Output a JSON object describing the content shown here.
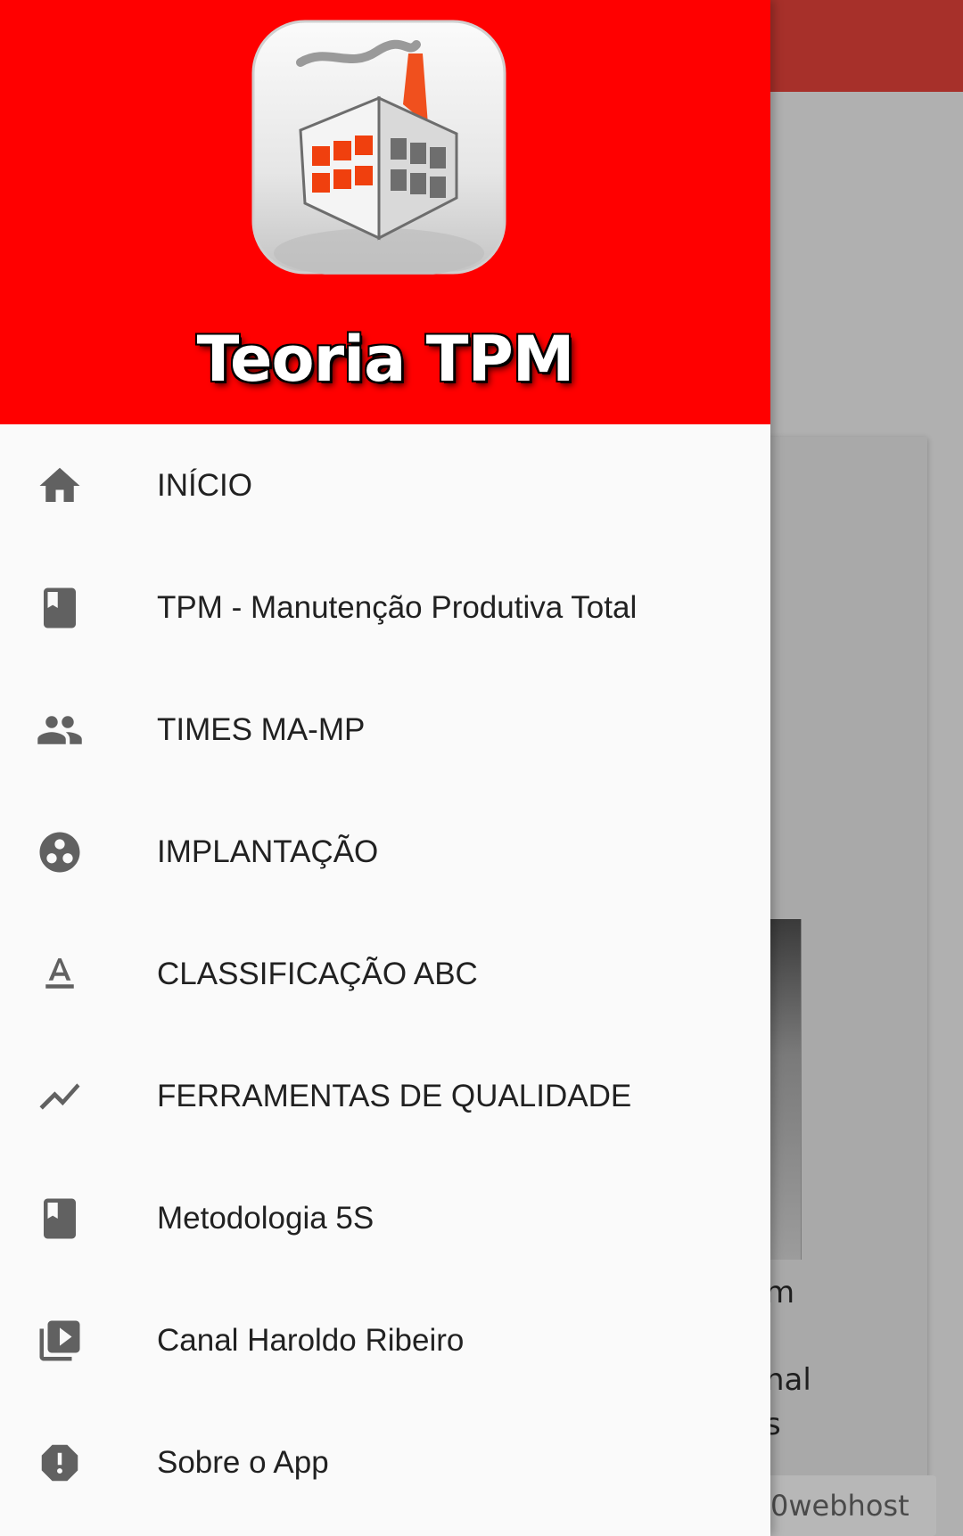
{
  "drawer": {
    "header": {
      "app_name": "Teoria TPM",
      "background_color": "#ff0000",
      "logo": "factory-logo"
    },
    "items": [
      {
        "label": "INÍCIO",
        "icon": "home-icon"
      },
      {
        "label": "TPM - Manutenção Produtiva Total",
        "icon": "book-icon"
      },
      {
        "label": "TIMES MA-MP",
        "icon": "people-icon"
      },
      {
        "label": "IMPLANTAÇÃO",
        "icon": "workspaces-icon"
      },
      {
        "label": "CLASSIFICAÇÃO ABC",
        "icon": "text-format-icon"
      },
      {
        "label": "FERRAMENTAS DE QUALIDADE",
        "icon": "trending-icon"
      },
      {
        "label": "Metodologia 5S",
        "icon": "book-icon"
      },
      {
        "label": "Canal Haroldo Ribeiro",
        "icon": "video-library-icon"
      },
      {
        "label": "Sobre o App",
        "icon": "alert-icon"
      }
    ],
    "icon_color": "#616161"
  },
  "background": {
    "text_1": "m",
    "text_2": "nal",
    "text_3": "s",
    "footer_text": "0webhost",
    "appbar_color": "#a7302a"
  }
}
